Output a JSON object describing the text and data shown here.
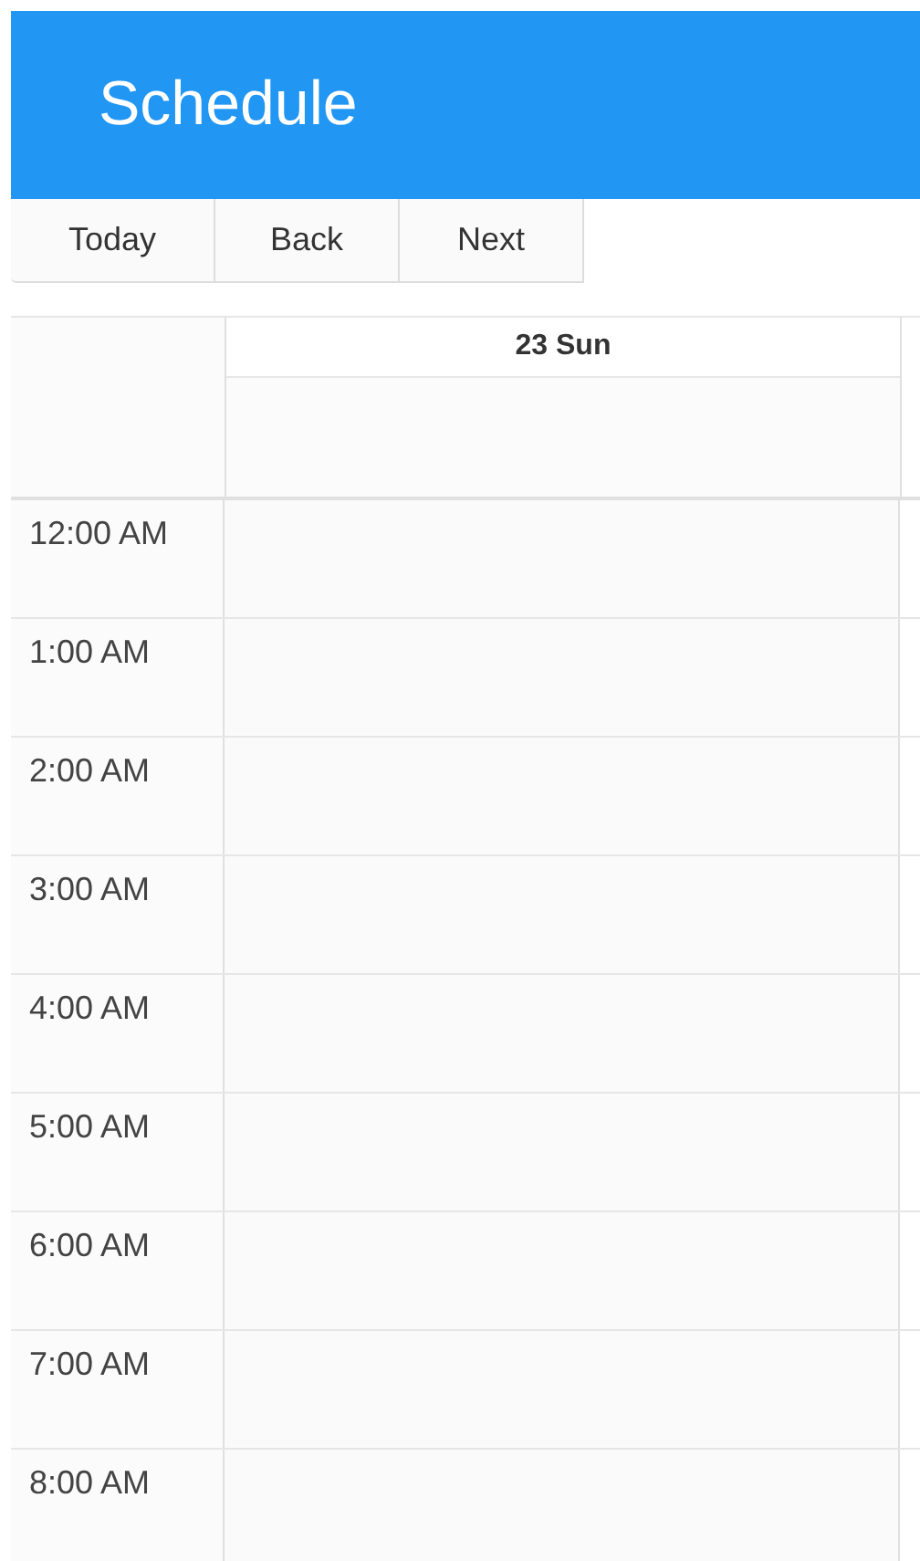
{
  "header": {
    "title": "Schedule"
  },
  "toolbar": {
    "buttons": [
      "Today",
      "Back",
      "Next"
    ]
  },
  "schedule": {
    "days": [
      "23 Sun"
    ],
    "hours": [
      "12:00 AM",
      "1:00 AM",
      "2:00 AM",
      "3:00 AM",
      "4:00 AM",
      "5:00 AM",
      "6:00 AM",
      "7:00 AM",
      "8:00 AM"
    ]
  }
}
